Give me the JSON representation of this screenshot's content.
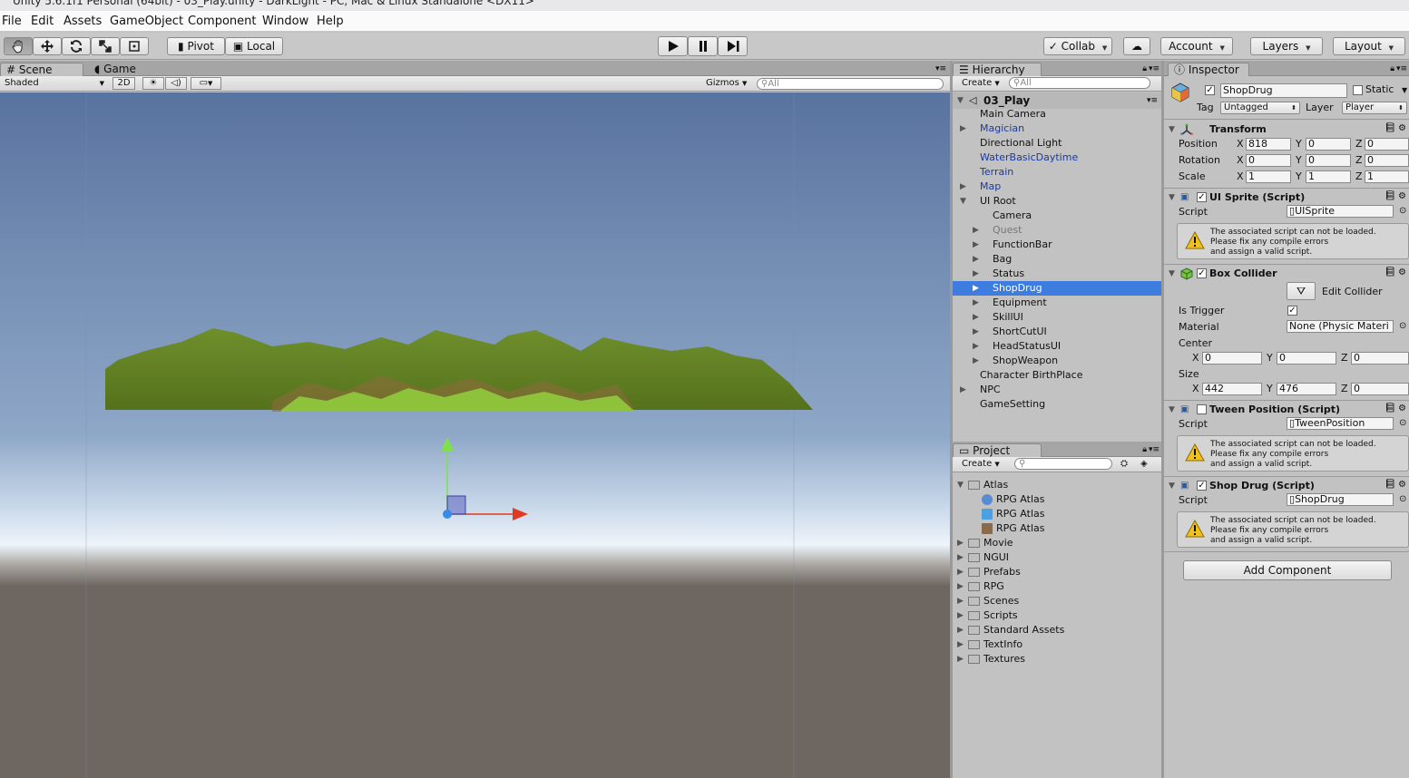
{
  "window": {
    "title": "Unity 5.6.1f1 Personal (64bit) - 03_Play.unity - DarkLight - PC, Mac & Linux Standalone <DX11>"
  },
  "menu": [
    "File",
    "Edit",
    "Assets",
    "GameObject",
    "Component",
    "Window",
    "Help"
  ],
  "toolbar": {
    "pivot": "Pivot",
    "local": "Local",
    "collab": "Collab",
    "account": "Account",
    "layers": "Layers",
    "layout": "Layout"
  },
  "scene": {
    "tab_scene": "Scene",
    "tab_game": "Game",
    "shading": "Shaded",
    "mode_2d": "2D",
    "gizmos": "Gizmos",
    "search_placeholder": "All"
  },
  "hierarchy": {
    "tab": "Hierarchy",
    "create": "Create",
    "search_placeholder": "All",
    "scene_name": "03_Play",
    "items": [
      {
        "label": "Main Camera",
        "depth": 0,
        "expandable": false,
        "style": "normal"
      },
      {
        "label": "Magician",
        "depth": 0,
        "expandable": true,
        "style": "blue"
      },
      {
        "label": "Directional Light",
        "depth": 0,
        "expandable": false,
        "style": "normal"
      },
      {
        "label": "WaterBasicDaytime",
        "depth": 0,
        "expandable": false,
        "style": "blue"
      },
      {
        "label": "Terrain",
        "depth": 0,
        "expandable": false,
        "style": "blue"
      },
      {
        "label": "Map",
        "depth": 0,
        "expandable": true,
        "style": "blue"
      },
      {
        "label": "UI Root",
        "depth": 0,
        "expandable": true,
        "expanded": true,
        "style": "normal"
      },
      {
        "label": "Camera",
        "depth": 1,
        "expandable": false,
        "style": "normal"
      },
      {
        "label": "Quest",
        "depth": 1,
        "expandable": true,
        "style": "gray"
      },
      {
        "label": "FunctionBar",
        "depth": 1,
        "expandable": true,
        "style": "normal"
      },
      {
        "label": "Bag",
        "depth": 1,
        "expandable": true,
        "style": "normal"
      },
      {
        "label": "Status",
        "depth": 1,
        "expandable": true,
        "style": "normal"
      },
      {
        "label": "ShopDrug",
        "depth": 1,
        "expandable": true,
        "style": "selected"
      },
      {
        "label": "Equipment",
        "depth": 1,
        "expandable": true,
        "style": "normal"
      },
      {
        "label": "SkillUI",
        "depth": 1,
        "expandable": true,
        "style": "normal"
      },
      {
        "label": "ShortCutUI",
        "depth": 1,
        "expandable": true,
        "style": "normal"
      },
      {
        "label": "HeadStatusUI",
        "depth": 1,
        "expandable": true,
        "style": "normal"
      },
      {
        "label": "ShopWeapon",
        "depth": 1,
        "expandable": true,
        "style": "normal"
      },
      {
        "label": "Character BirthPlace",
        "depth": 0,
        "expandable": false,
        "style": "normal"
      },
      {
        "label": "NPC",
        "depth": 0,
        "expandable": true,
        "style": "normal"
      },
      {
        "label": "GameSetting",
        "depth": 0,
        "expandable": false,
        "style": "normal"
      }
    ]
  },
  "project": {
    "tab": "Project",
    "create": "Create",
    "items": [
      {
        "label": "Atlas",
        "depth": 0,
        "expanded": true
      },
      {
        "label": "RPG Atlas",
        "depth": 1,
        "icon": "sprite-icon"
      },
      {
        "label": "RPG Atlas",
        "depth": 1,
        "icon": "prefab-icon"
      },
      {
        "label": "RPG Atlas",
        "depth": 1,
        "icon": "texture-icon"
      },
      {
        "label": "Movie",
        "depth": 0
      },
      {
        "label": "NGUI",
        "depth": 0
      },
      {
        "label": "Prefabs",
        "depth": 0
      },
      {
        "label": "RPG",
        "depth": 0
      },
      {
        "label": "Scenes",
        "depth": 0
      },
      {
        "label": "Scripts",
        "depth": 0
      },
      {
        "label": "Standard Assets",
        "depth": 0
      },
      {
        "label": "TextInfo",
        "depth": 0
      },
      {
        "label": "Textures",
        "depth": 0
      }
    ]
  },
  "inspector": {
    "tab": "Inspector",
    "object_name": "ShopDrug",
    "static_label": "Static",
    "tag_label": "Tag",
    "tag_value": "Untagged",
    "layer_label": "Layer",
    "layer_value": "Player",
    "transform": {
      "title": "Transform",
      "position": {
        "label": "Position",
        "x": "818",
        "y": "0",
        "z": "0"
      },
      "rotation": {
        "label": "Rotation",
        "x": "0",
        "y": "0",
        "z": "0"
      },
      "scale": {
        "label": "Scale",
        "x": "1",
        "y": "1",
        "z": "1"
      }
    },
    "ui_sprite": {
      "title": "UI Sprite (Script)",
      "script_label": "Script",
      "script_value": "UISprite"
    },
    "warning": "The associated script can not be loaded.\nPlease fix any compile errors\nand assign a valid script.",
    "box_collider": {
      "title": "Box Collider",
      "edit_collider": "Edit Collider",
      "is_trigger_label": "Is Trigger",
      "material_label": "Material",
      "material_value": "None (Physic Materi",
      "center_label": "Center",
      "center": {
        "x": "0",
        "y": "0",
        "z": "0"
      },
      "size_label": "Size",
      "size": {
        "x": "442",
        "y": "476",
        "z": "0"
      }
    },
    "tween_position": {
      "title": "Tween Position (Script)",
      "script_label": "Script",
      "script_value": "TweenPosition"
    },
    "shop_drug": {
      "title": "Shop Drug (Script)",
      "script_label": "Script",
      "script_value": "ShopDrug"
    },
    "add_component": "Add Component",
    "axis": {
      "x": "X",
      "y": "Y",
      "z": "Z"
    }
  },
  "colors": {
    "selection": "#3d7de0",
    "sky_top": "#5a76a0",
    "ground": "#6e6661",
    "terrain": "#6b8a2a"
  }
}
